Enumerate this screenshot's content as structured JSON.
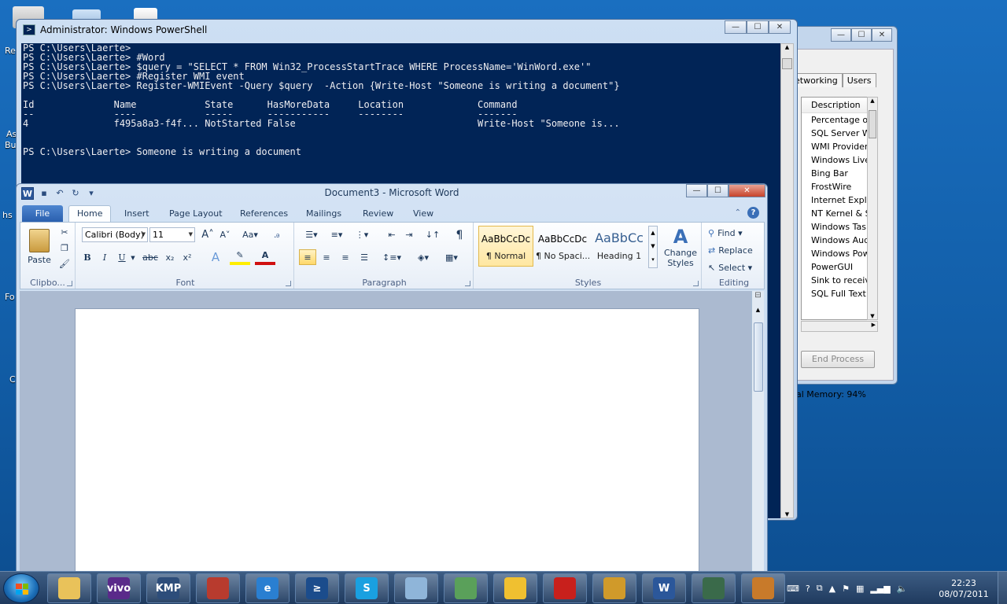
{
  "desktop": {
    "fragments": [
      "Re",
      "As",
      "Bu",
      "hs",
      "Fo",
      "C"
    ]
  },
  "task_manager": {
    "tabs": [
      "etworking",
      "Users"
    ],
    "list_header": "Description",
    "items": [
      "Percentage o",
      "SQL Server W",
      "WMI Provider",
      "Windows Live",
      "Bing Bar",
      "FrostWire",
      "Internet Explo",
      "NT Kernel & S",
      "Windows Task",
      "Windows Aud",
      "Windows Pow",
      "PowerGUI",
      "Sink to receiv",
      "SQL Full Text"
    ],
    "end_process": "End Process",
    "memory": "al Memory: 94%"
  },
  "powershell": {
    "title": "Administrator: Windows PowerShell",
    "lines": [
      "PS C:\\Users\\Laerte>",
      "PS C:\\Users\\Laerte> #Word",
      "PS C:\\Users\\Laerte> $query = \"SELECT * FROM Win32_ProcessStartTrace WHERE ProcessName='WinWord.exe'\"",
      "PS C:\\Users\\Laerte> #Register WMI event",
      "PS C:\\Users\\Laerte> Register-WMIEvent -Query $query  -Action {Write-Host \"Someone is writing a document\"}",
      "",
      "Id              Name            State      HasMoreData     Location             Command",
      "--              ----            -----      -----------     --------             -------",
      "4               f495a8a3-f4f... NotStarted False                                Write-Host \"Someone is...",
      "",
      "",
      "PS C:\\Users\\Laerte> Someone is writing a document"
    ]
  },
  "word": {
    "title": "Document3  -  Microsoft Word",
    "file_tab": "File",
    "tabs": [
      "Home",
      "Insert",
      "Page Layout",
      "References",
      "Mailings",
      "Review",
      "View"
    ],
    "clipboard": {
      "paste": "Paste",
      "label": "Clipbo..."
    },
    "font": {
      "name": "Calibri (Body)",
      "size": "11",
      "label": "Font",
      "bold": "B",
      "italic": "I",
      "underline": "U",
      "strike": "abc",
      "sub": "x₂",
      "sup": "x²",
      "grow": "A",
      "shrink": "A",
      "case": "Aa",
      "color_a": "A"
    },
    "paragraph": {
      "label": "Paragraph",
      "pilcrow": "¶"
    },
    "styles": {
      "label": "Styles",
      "items": [
        {
          "sample": "AaBbCcDc",
          "name": "¶ Normal"
        },
        {
          "sample": "AaBbCcDc",
          "name": "¶ No Spaci..."
        },
        {
          "sample": "AaBbCc",
          "name": "Heading 1"
        }
      ],
      "change_styles_1": "Change",
      "change_styles_2": "Styles"
    },
    "editing": {
      "label": "Editing",
      "find": "Find",
      "replace": "Replace",
      "select": "Select"
    }
  },
  "taskbar": {
    "apps": [
      {
        "name": "explorer",
        "label": "",
        "color": "#e9c25a"
      },
      {
        "name": "vivo",
        "label": "vivo",
        "color": "#5a2a8a"
      },
      {
        "name": "kmplayer",
        "label": "KMP",
        "color": "#2d4d7a"
      },
      {
        "name": "fireworks-tool",
        "label": "",
        "color": "#b83b2e"
      },
      {
        "name": "internet-explorer",
        "label": "e",
        "color": "#2a7fd1"
      },
      {
        "name": "powershell",
        "label": "≥",
        "color": "#1b4c8c"
      },
      {
        "name": "skype",
        "label": "S",
        "color": "#1aa0e0"
      },
      {
        "name": "notepad-tool",
        "label": "",
        "color": "#8fb5d9"
      },
      {
        "name": "network-tool",
        "label": "",
        "color": "#5aa05a"
      },
      {
        "name": "bird-app",
        "label": "",
        "color": "#f0c030"
      },
      {
        "name": "adobe-reader",
        "label": "",
        "color": "#c8201c"
      },
      {
        "name": "tool-app",
        "label": "",
        "color": "#d09a2a"
      },
      {
        "name": "word",
        "label": "W",
        "color": "#2b579a"
      },
      {
        "name": "monitor-app",
        "label": "",
        "color": "#3a6a4a"
      },
      {
        "name": "paint-app",
        "label": "",
        "color": "#c87a2a"
      }
    ],
    "time": "22:23",
    "date": "08/07/2011"
  }
}
